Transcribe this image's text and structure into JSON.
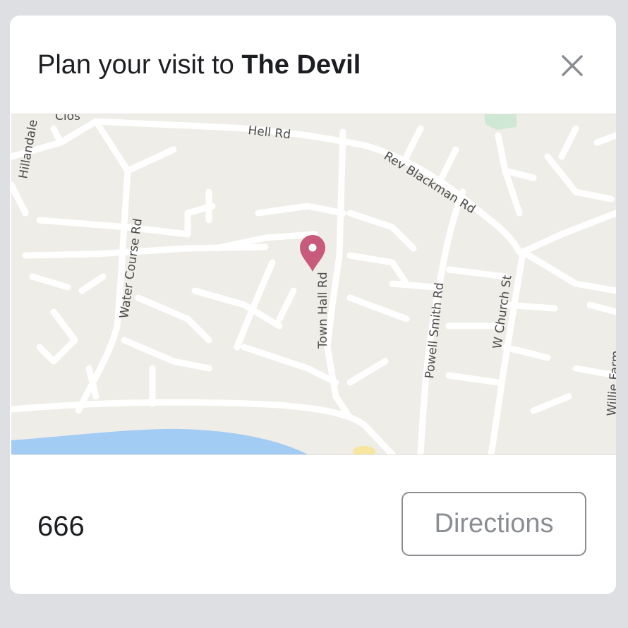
{
  "dialog": {
    "title_prefix": "Plan your visit to ",
    "venue_name": "The Devil",
    "close_icon": "close-icon"
  },
  "map": {
    "marker_icon": "map-pin-icon",
    "marker_color": "#c85a7c",
    "water_color": "#a3ccf5",
    "road_labels": {
      "clos": "Clos",
      "hillandale": "Hillandale",
      "hell_rd": "Hell Rd",
      "rev_blackman_rd": "Rev Blackman Rd",
      "water_course_rd": "Water Course Rd",
      "town_hall_rd": "Town Hall Rd",
      "powell_smith_rd": "Powell Smith Rd",
      "w_church_st": "W Church St",
      "willie": "Willie Farm"
    }
  },
  "footer": {
    "value": "666",
    "directions_label": "Directions"
  }
}
